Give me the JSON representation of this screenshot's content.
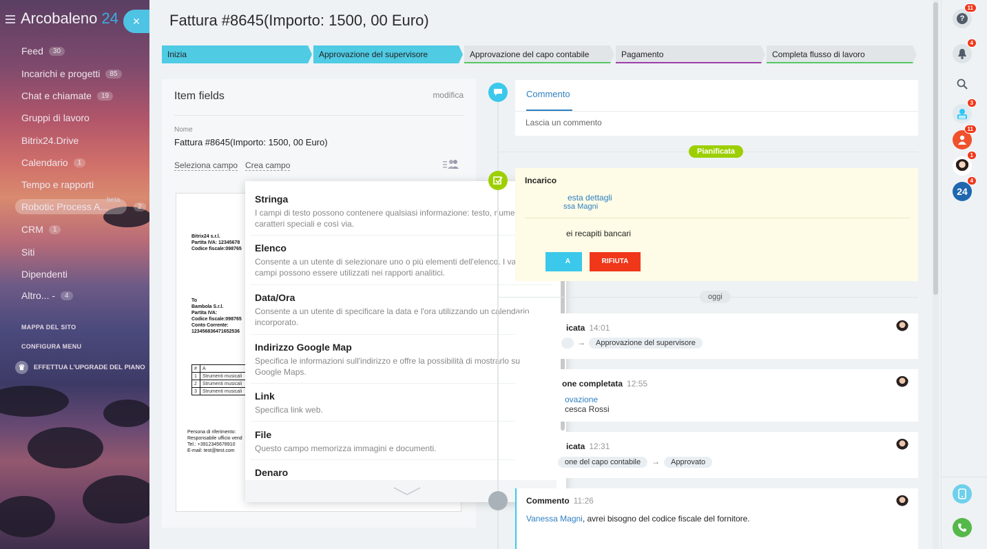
{
  "sidebar": {
    "brand_name": "Arcobaleno",
    "brand_number": "24",
    "close_symbol": "×",
    "items": [
      {
        "label": "Feed",
        "count": "30"
      },
      {
        "label": "Incarichi e progetti",
        "count": "85"
      },
      {
        "label": "Chat e chiamate",
        "count": "19"
      },
      {
        "label": "Gruppi di lavoro",
        "count": ""
      },
      {
        "label": "Bitrix24.Drive",
        "count": ""
      },
      {
        "label": "Calendario",
        "count": "1"
      },
      {
        "label": "Tempo e rapporti",
        "count": ""
      },
      {
        "label": "Robotic Process A...",
        "count": "2",
        "badge": "beta"
      },
      {
        "label": "CRM",
        "count": "1"
      },
      {
        "label": "Siti",
        "count": ""
      },
      {
        "label": "Dipendenti",
        "count": ""
      },
      {
        "label": "Altro... -",
        "count": "4"
      }
    ],
    "site_map": "MAPPA DEL SITO",
    "configure_menu": "CONFIGURA MENU",
    "upgrade": "EFFETTUA L'UPGRADE DEL PIANO"
  },
  "header": {
    "title": "Fattura #8645(Importo: 1500, 00 Euro)"
  },
  "stages": [
    {
      "label": "Inizia",
      "bg": "#4fcbe4",
      "line": "#4fcbe4"
    },
    {
      "label": "Approvazione del supervisore",
      "bg": "#4fcbe4",
      "line": "#4fcbe4"
    },
    {
      "label": "Approvazione del capo contabile",
      "bg": "#e1e5e8",
      "line": "#57c765"
    },
    {
      "label": "Pagamento",
      "bg": "#e1e5e8",
      "line": "#9b3fa8"
    },
    {
      "label": "Completa flusso di lavoro",
      "bg": "#e1e5e8",
      "line": "#57c765"
    }
  ],
  "item_fields": {
    "title": "Item fields",
    "edit": "modifica",
    "name_label": "Nome",
    "name_value": "Fattura #8645(Importo: 1500, 00 Euro)",
    "select_field": "Seleziona campo",
    "create_field": "Crea campo"
  },
  "document": {
    "company": "Bitrix24 s.r.l.\nPartita IVA: 12345678\nCodice fiscale:098765",
    "to": "To\nBambola S.r.l.\nPartita IVA:\nCodice fiscale:098765\nConto Corrente:\n123456836471652536",
    "table_header": [
      "#",
      "A"
    ],
    "table_rows": [
      [
        "1",
        "Strumenti musicali"
      ],
      [
        "2",
        "Strumenti musicali"
      ],
      [
        "3",
        "Strumenti musicali"
      ]
    ],
    "footer": "Persona di riferimento:\nResponsabile ufficio vend\nTel.: +3912345678910\nE-mail: test@test.com"
  },
  "field_types": [
    {
      "title": "Stringa",
      "desc": "I campi di testo possono contenere qualsiasi informazione: testo, numeri, caratteri speciali e così via."
    },
    {
      "title": "Elenco",
      "desc": "Consente a un utente di selezionare uno o più elementi dell'elenco. I valori dei campi possono essere utilizzati nei rapporti analitici."
    },
    {
      "title": "Data/Ora",
      "desc": "Consente a un utente di specificare la data e l'ora utilizzando un calendario incorporato."
    },
    {
      "title": "Indirizzo Google Map",
      "desc": "Specifica le informazioni sull'indirizzo e offre la possibilità di mostrarlo su Google Maps."
    },
    {
      "title": "Link",
      "desc": "Specifica link web."
    },
    {
      "title": "File",
      "desc": "Questo campo memorizza immagini e documenti."
    },
    {
      "title": "Denaro",
      "desc": ""
    }
  ],
  "comment": {
    "tab": "Commento",
    "placeholder": "Lascia un commento"
  },
  "planned_label": "Pianificata",
  "today_label": "oggi",
  "task": {
    "title": "Incarico",
    "link": "esta dettagli",
    "person": "ssa Magni",
    "text": "ei recapiti bancari",
    "approve": "A",
    "reject": "RIFIUTA"
  },
  "events": [
    {
      "head": "icata",
      "time": "14:01",
      "from": "",
      "to": "Approvazione del supervisore"
    },
    {
      "head": "one completata",
      "time": "12:55",
      "link": "ovazione",
      "text": "cesca Rossi"
    },
    {
      "head": "icata",
      "time": "12:31",
      "from": "one del capo contabile",
      "to": "Approvato"
    },
    {
      "head": "Commento",
      "time": "11:26",
      "author": "Vanessa Magni",
      "text": ", avrei bisogno del codice fiscale del fornitore."
    }
  ],
  "right_bar": {
    "help_count": "11",
    "notifications_count": "4",
    "r1_count": "3",
    "r2_count": "11",
    "r3_count": "1",
    "r4_count": "4",
    "r4_label": "24"
  }
}
